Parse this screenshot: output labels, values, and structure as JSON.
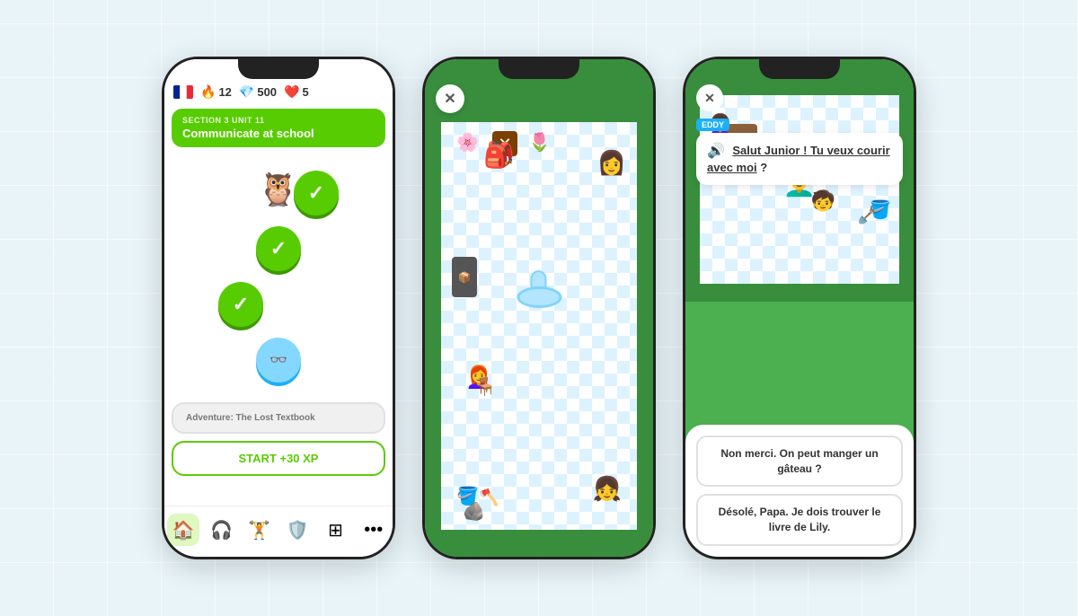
{
  "background": {
    "color": "#e8f4f8"
  },
  "phone1": {
    "stats": {
      "streak": "12",
      "gems": "500",
      "hearts": "5"
    },
    "section": {
      "label": "SECTION 3  UNIT 11",
      "title": "Communicate at school"
    },
    "nodes": [
      {
        "type": "complete",
        "offset": "right"
      },
      {
        "type": "complete",
        "offset": "center"
      },
      {
        "type": "complete",
        "offset": "left"
      },
      {
        "type": "locked",
        "offset": "center"
      }
    ],
    "adventure": {
      "label": "Adventure: The Lost Textbook",
      "start_btn": "START +30 XP"
    },
    "nav": {
      "home": "🏠",
      "learn": "🎧",
      "practice": "🏋️",
      "shield": "🛡️",
      "quest": "🔲",
      "more": "⋯"
    }
  },
  "phone2": {
    "close_btn": "✕"
  },
  "phone3": {
    "close_btn": "✕",
    "eddy_name": "EDDY",
    "speech": "Salut Junior ! Tu veux courir avec moi ?",
    "responses": [
      "Non merci. On peut manger un gâteau ?",
      "Désolé, Papa. Je dois trouver le livre de Lily."
    ]
  }
}
